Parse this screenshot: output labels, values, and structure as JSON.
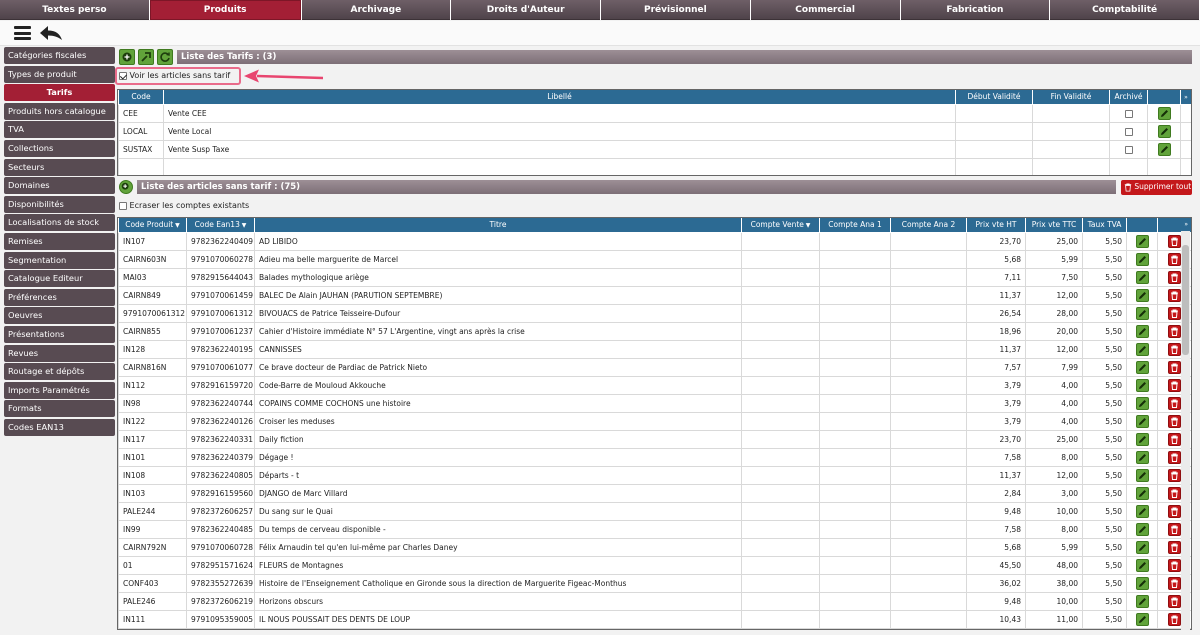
{
  "top_tabs": [
    "Textes perso",
    "Produits",
    "Archivage",
    "Droits d'Auteur",
    "Prévisionnel",
    "Commercial",
    "Fabrication",
    "Comptabilité"
  ],
  "active_tab": "Produits",
  "sidebar": {
    "items": [
      "Catégories fiscales",
      "Types de produit",
      "Tarifs",
      "Produits hors catalogue",
      "TVA",
      "Collections",
      "Secteurs",
      "Domaines",
      "Disponibilités",
      "Localisations de stock",
      "Remises",
      "Segmentation",
      "Catalogue Editeur",
      "Préférences",
      "Oeuvres",
      "Présentations",
      "Revues",
      "Routage et dépôts",
      "Imports Paramétrés",
      "Formats",
      "Codes EAN13"
    ],
    "active": "Tarifs"
  },
  "tarifs": {
    "title": "Liste des Tarifs : (3)",
    "checkbox_label": "Voir les articles sans tarif",
    "columns": [
      "Code",
      "Libellé",
      "Début Validité",
      "Fin Validité",
      "Archivé"
    ],
    "rows": [
      {
        "code": "CEE",
        "libelle": "Vente CEE",
        "debut": "",
        "fin": ""
      },
      {
        "code": "LOCAL",
        "libelle": "Vente Local",
        "debut": "",
        "fin": ""
      },
      {
        "code": "SUSTAX",
        "libelle": "Vente Susp Taxe",
        "debut": "",
        "fin": ""
      }
    ]
  },
  "articles": {
    "title": "Liste des articles sans tarif : (75)",
    "delete_all_label": "Supprimer tout",
    "overwrite_label": "Ecraser les comptes existants",
    "columns": [
      "Code Produit",
      "Code Ean13",
      "Titre",
      "Compte Vente",
      "Compte Ana 1",
      "Compte Ana 2",
      "Prix vte HT",
      "Prix vte TTC",
      "Taux TVA"
    ],
    "rows": [
      [
        "IN107",
        "9782362240409",
        "AD LIBIDO",
        "23,70",
        "25,00",
        "5,50"
      ],
      [
        "CAIRN603N",
        "9791070060278",
        "Adieu ma belle marguerite de Marcel",
        "5,68",
        "5,99",
        "5,50"
      ],
      [
        "MAI03",
        "9782915644043",
        "Balades mythologique ariège",
        "7,11",
        "7,50",
        "5,50"
      ],
      [
        "CAIRN849",
        "9791070061459",
        "BALEC De Alain JAUHAN (PARUTION SEPTEMBRE)",
        "11,37",
        "12,00",
        "5,50"
      ],
      [
        "9791070061312",
        "9791070061312",
        "BIVOUACS de Patrice Teisseire-Dufour",
        "26,54",
        "28,00",
        "5,50"
      ],
      [
        "CAIRN855",
        "9791070061237",
        "Cahier d'Histoire immédiate N° 57 L'Argentine, vingt ans après la crise",
        "18,96",
        "20,00",
        "5,50"
      ],
      [
        "IN128",
        "9782362240195",
        "CANNISSES",
        "11,37",
        "12,00",
        "5,50"
      ],
      [
        "CAIRN816N",
        "9791070061077",
        "Ce brave docteur de Pardiac de Patrick Nieto",
        "7,57",
        "7,99",
        "5,50"
      ],
      [
        "IN112",
        "9782916159720",
        "Code-Barre de Mouloud Akkouche",
        "3,79",
        "4,00",
        "5,50"
      ],
      [
        "IN98",
        "9782362240744",
        "COPAINS COMME COCHONS une histoire",
        "3,79",
        "4,00",
        "5,50"
      ],
      [
        "IN122",
        "9782362240126",
        "Croiser les meduses",
        "3,79",
        "4,00",
        "5,50"
      ],
      [
        "IN117",
        "9782362240331",
        "Daily fiction",
        "23,70",
        "25,00",
        "5,50"
      ],
      [
        "IN101",
        "9782362240379",
        "Dégage !",
        "7,58",
        "8,00",
        "5,50"
      ],
      [
        "IN108",
        "9782362240805",
        "Départs - t",
        "11,37",
        "12,00",
        "5,50"
      ],
      [
        "IN103",
        "9782916159560",
        "DJANGO de Marc Villard",
        "2,84",
        "3,00",
        "5,50"
      ],
      [
        "PALE244",
        "9782372606257",
        "Du sang sur le Quai",
        "9,48",
        "10,00",
        "5,50"
      ],
      [
        "IN99",
        "9782362240485",
        "Du temps de cerveau disponible -",
        "7,58",
        "8,00",
        "5,50"
      ],
      [
        "CAIRN792N",
        "9791070060728",
        "Félix Arnaudin tel qu'en lui-même par Charles Daney",
        "5,68",
        "5,99",
        "5,50"
      ],
      [
        "01",
        "9782951571624",
        "FLEURS de Montagnes",
        "45,50",
        "48,00",
        "5,50"
      ],
      [
        "CONF403",
        "9782355272639",
        "Histoire de l'Enseignement Catholique en Gironde sous la direction de Marguerite Figeac-Monthus",
        "36,02",
        "38,00",
        "5,50"
      ],
      [
        "PALE246",
        "9782372606219",
        "Horizons obscurs",
        "9,48",
        "10,00",
        "5,50"
      ],
      [
        "IN111",
        "9791095359005",
        "IL NOUS POUSSAIT DES DENTS DE LOUP",
        "10,43",
        "11,00",
        "5,50"
      ]
    ]
  }
}
